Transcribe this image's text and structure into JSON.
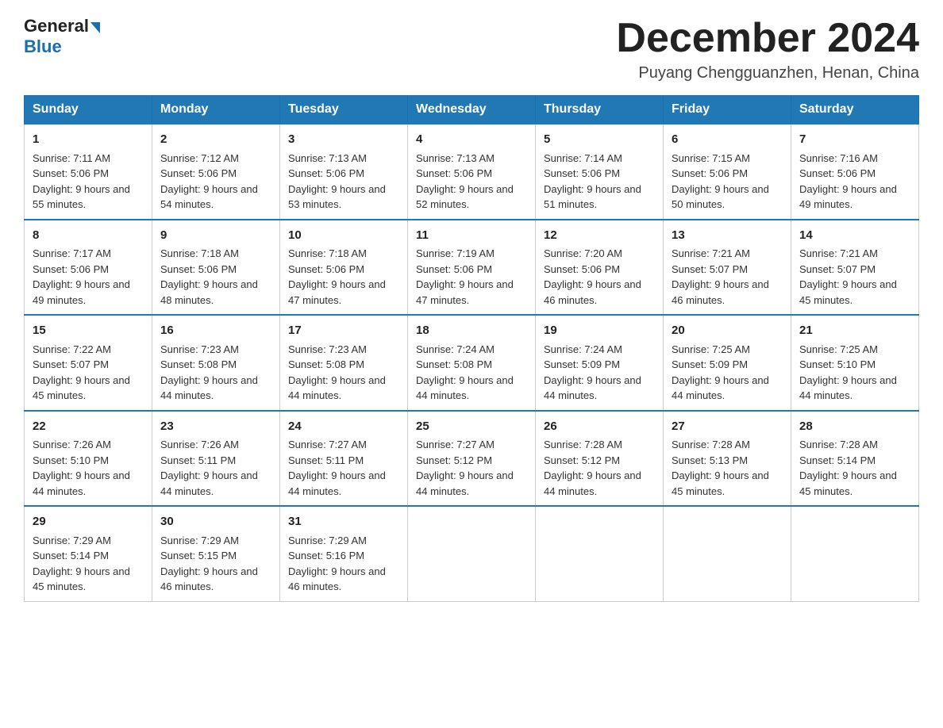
{
  "header": {
    "logo_general": "General",
    "logo_blue": "Blue",
    "month_title": "December 2024",
    "subtitle": "Puyang Chengguanzhen, Henan, China"
  },
  "days_of_week": [
    "Sunday",
    "Monday",
    "Tuesday",
    "Wednesday",
    "Thursday",
    "Friday",
    "Saturday"
  ],
  "weeks": [
    [
      {
        "day": "1",
        "sunrise": "7:11 AM",
        "sunset": "5:06 PM",
        "daylight": "9 hours and 55 minutes."
      },
      {
        "day": "2",
        "sunrise": "7:12 AM",
        "sunset": "5:06 PM",
        "daylight": "9 hours and 54 minutes."
      },
      {
        "day": "3",
        "sunrise": "7:13 AM",
        "sunset": "5:06 PM",
        "daylight": "9 hours and 53 minutes."
      },
      {
        "day": "4",
        "sunrise": "7:13 AM",
        "sunset": "5:06 PM",
        "daylight": "9 hours and 52 minutes."
      },
      {
        "day": "5",
        "sunrise": "7:14 AM",
        "sunset": "5:06 PM",
        "daylight": "9 hours and 51 minutes."
      },
      {
        "day": "6",
        "sunrise": "7:15 AM",
        "sunset": "5:06 PM",
        "daylight": "9 hours and 50 minutes."
      },
      {
        "day": "7",
        "sunrise": "7:16 AM",
        "sunset": "5:06 PM",
        "daylight": "9 hours and 49 minutes."
      }
    ],
    [
      {
        "day": "8",
        "sunrise": "7:17 AM",
        "sunset": "5:06 PM",
        "daylight": "9 hours and 49 minutes."
      },
      {
        "day": "9",
        "sunrise": "7:18 AM",
        "sunset": "5:06 PM",
        "daylight": "9 hours and 48 minutes."
      },
      {
        "day": "10",
        "sunrise": "7:18 AM",
        "sunset": "5:06 PM",
        "daylight": "9 hours and 47 minutes."
      },
      {
        "day": "11",
        "sunrise": "7:19 AM",
        "sunset": "5:06 PM",
        "daylight": "9 hours and 47 minutes."
      },
      {
        "day": "12",
        "sunrise": "7:20 AM",
        "sunset": "5:06 PM",
        "daylight": "9 hours and 46 minutes."
      },
      {
        "day": "13",
        "sunrise": "7:21 AM",
        "sunset": "5:07 PM",
        "daylight": "9 hours and 46 minutes."
      },
      {
        "day": "14",
        "sunrise": "7:21 AM",
        "sunset": "5:07 PM",
        "daylight": "9 hours and 45 minutes."
      }
    ],
    [
      {
        "day": "15",
        "sunrise": "7:22 AM",
        "sunset": "5:07 PM",
        "daylight": "9 hours and 45 minutes."
      },
      {
        "day": "16",
        "sunrise": "7:23 AM",
        "sunset": "5:08 PM",
        "daylight": "9 hours and 44 minutes."
      },
      {
        "day": "17",
        "sunrise": "7:23 AM",
        "sunset": "5:08 PM",
        "daylight": "9 hours and 44 minutes."
      },
      {
        "day": "18",
        "sunrise": "7:24 AM",
        "sunset": "5:08 PM",
        "daylight": "9 hours and 44 minutes."
      },
      {
        "day": "19",
        "sunrise": "7:24 AM",
        "sunset": "5:09 PM",
        "daylight": "9 hours and 44 minutes."
      },
      {
        "day": "20",
        "sunrise": "7:25 AM",
        "sunset": "5:09 PM",
        "daylight": "9 hours and 44 minutes."
      },
      {
        "day": "21",
        "sunrise": "7:25 AM",
        "sunset": "5:10 PM",
        "daylight": "9 hours and 44 minutes."
      }
    ],
    [
      {
        "day": "22",
        "sunrise": "7:26 AM",
        "sunset": "5:10 PM",
        "daylight": "9 hours and 44 minutes."
      },
      {
        "day": "23",
        "sunrise": "7:26 AM",
        "sunset": "5:11 PM",
        "daylight": "9 hours and 44 minutes."
      },
      {
        "day": "24",
        "sunrise": "7:27 AM",
        "sunset": "5:11 PM",
        "daylight": "9 hours and 44 minutes."
      },
      {
        "day": "25",
        "sunrise": "7:27 AM",
        "sunset": "5:12 PM",
        "daylight": "9 hours and 44 minutes."
      },
      {
        "day": "26",
        "sunrise": "7:28 AM",
        "sunset": "5:12 PM",
        "daylight": "9 hours and 44 minutes."
      },
      {
        "day": "27",
        "sunrise": "7:28 AM",
        "sunset": "5:13 PM",
        "daylight": "9 hours and 45 minutes."
      },
      {
        "day": "28",
        "sunrise": "7:28 AM",
        "sunset": "5:14 PM",
        "daylight": "9 hours and 45 minutes."
      }
    ],
    [
      {
        "day": "29",
        "sunrise": "7:29 AM",
        "sunset": "5:14 PM",
        "daylight": "9 hours and 45 minutes."
      },
      {
        "day": "30",
        "sunrise": "7:29 AM",
        "sunset": "5:15 PM",
        "daylight": "9 hours and 46 minutes."
      },
      {
        "day": "31",
        "sunrise": "7:29 AM",
        "sunset": "5:16 PM",
        "daylight": "9 hours and 46 minutes."
      },
      null,
      null,
      null,
      null
    ]
  ]
}
